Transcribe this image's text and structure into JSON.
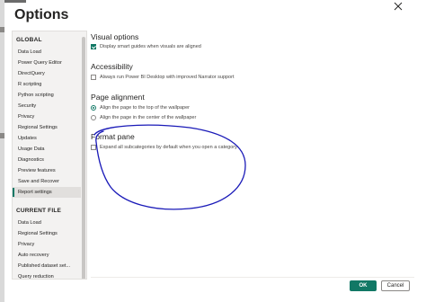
{
  "window": {
    "title": "Options"
  },
  "sidebar": {
    "global_header": "GLOBAL",
    "global_items": [
      {
        "label": "Data Load",
        "active": false
      },
      {
        "label": "Power Query Editor",
        "active": false
      },
      {
        "label": "DirectQuery",
        "active": false
      },
      {
        "label": "R scripting",
        "active": false
      },
      {
        "label": "Python scripting",
        "active": false
      },
      {
        "label": "Security",
        "active": false
      },
      {
        "label": "Privacy",
        "active": false
      },
      {
        "label": "Regional Settings",
        "active": false
      },
      {
        "label": "Updates",
        "active": false
      },
      {
        "label": "Usage Data",
        "active": false
      },
      {
        "label": "Diagnostics",
        "active": false
      },
      {
        "label": "Preview features",
        "active": false
      },
      {
        "label": "Save and Recover",
        "active": false
      },
      {
        "label": "Report settings",
        "active": true
      }
    ],
    "file_header": "CURRENT FILE",
    "file_items": [
      {
        "label": "Data Load"
      },
      {
        "label": "Regional Settings"
      },
      {
        "label": "Privacy"
      },
      {
        "label": "Auto recovery"
      },
      {
        "label": "Published dataset set..."
      },
      {
        "label": "Query reduction"
      }
    ]
  },
  "main": {
    "visual_options": {
      "heading": "Visual options",
      "option": "Display smart guides when visuals are aligned",
      "checked": true
    },
    "accessibility": {
      "heading": "Accessibility",
      "option": "Always run Power BI Desktop with improved Narrator support",
      "checked": false
    },
    "page_alignment": {
      "heading": "Page alignment",
      "option_top": "Align the page to the top of the wallpaper",
      "option_center": "Align the page in the center of the wallpaper",
      "selected": "top"
    },
    "format_pane": {
      "heading": "Format pane",
      "option": "Expand all subcategories by default when you open a category",
      "checked": false
    }
  },
  "footer": {
    "ok_label": "OK",
    "cancel_label": "Cancel"
  },
  "colors": {
    "accent": "#117865",
    "annotation": "#1a1ab8"
  }
}
